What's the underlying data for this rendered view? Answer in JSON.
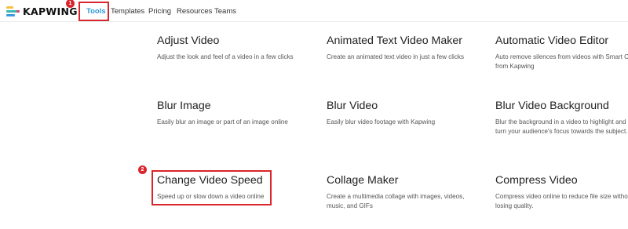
{
  "brand": {
    "name": "KAPWING",
    "logo_colors": [
      "#f6c243",
      "#3db8b0",
      "#e5426a",
      "#3b9be0"
    ]
  },
  "nav": {
    "items": [
      {
        "label": "Tools",
        "active": true
      },
      {
        "label": "Templates",
        "active": false
      },
      {
        "label": "Pricing",
        "active": false
      },
      {
        "label": "Resources",
        "active": false
      },
      {
        "label": "Teams",
        "active": false
      }
    ]
  },
  "annotations": {
    "step1": "1",
    "step2": "2",
    "color": "#d9252b"
  },
  "tools": [
    {
      "title": "Adjust Video",
      "desc": "Adjust the look and feel of a video in a few clicks"
    },
    {
      "title": "Animated Text Video Maker",
      "desc": "Create an animated text video in just a few clicks"
    },
    {
      "title": "Automatic Video Editor",
      "desc": "Auto remove silences from videos with Smart Cut from Kapwing"
    },
    {
      "title": "Blur Image",
      "desc": "Easily blur an image or part of an image online"
    },
    {
      "title": "Blur Video",
      "desc": "Easily blur video footage with Kapwing"
    },
    {
      "title": "Blur Video Background",
      "desc": "Blur the background in a video to highlight and turn your audience's focus towards the subject."
    },
    {
      "title": "Change Video Speed",
      "desc": "Speed up or slow down a video online"
    },
    {
      "title": "Collage Maker",
      "desc": "Create a multimedia collage with images, videos, music, and GIFs"
    },
    {
      "title": "Compress Video",
      "desc": "Compress video online to reduce file size without losing quality."
    }
  ]
}
